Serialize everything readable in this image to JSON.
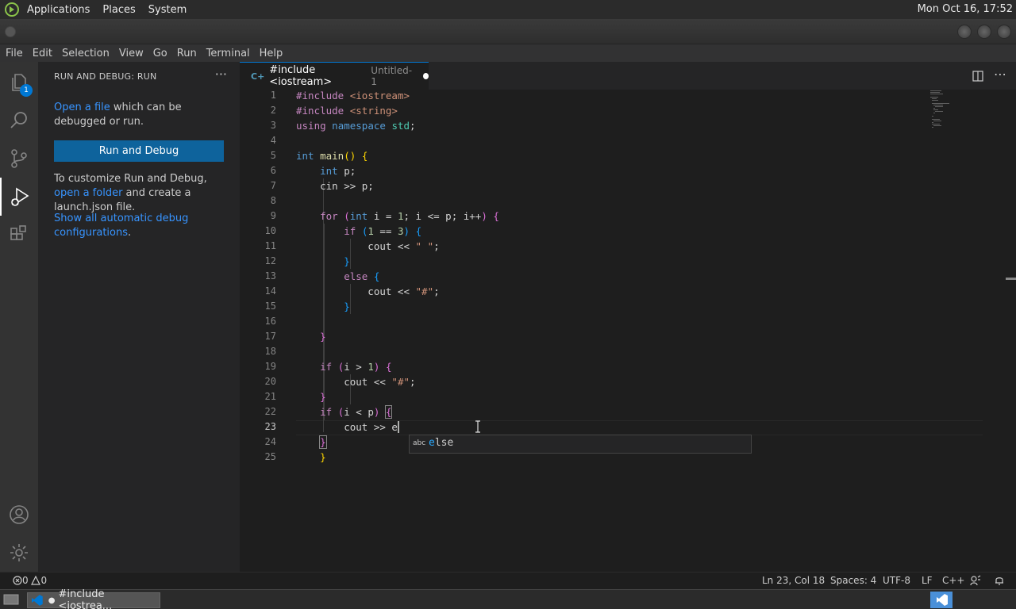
{
  "top_panel": {
    "menus": [
      "Applications",
      "Places",
      "System"
    ],
    "clock": "Mon Oct 16, 17:52"
  },
  "menu_bar": [
    "File",
    "Edit",
    "Selection",
    "View",
    "Go",
    "Run",
    "Terminal",
    "Help"
  ],
  "activity_bar": {
    "explorer_badge": "1",
    "icons": [
      "files-icon",
      "search-icon",
      "source-control-icon",
      "run-debug-icon",
      "extensions-icon",
      "account-icon",
      "gear-icon"
    ]
  },
  "sidebar": {
    "title": "RUN AND DEBUG: RUN",
    "more": "···",
    "open_file_link": "Open a file",
    "open_file_rest": " which can be debugged or run.",
    "run_button": "Run and Debug",
    "customize_prefix": "To customize Run and Debug, ",
    "open_folder_link": "open a folder",
    "customize_suffix": " and create a launch.json file.",
    "show_all_link": "Show all automatic debug configurations",
    "show_all_suffix": "."
  },
  "tab": {
    "icon": "C+",
    "title": "#include <iostream>",
    "subtitle": "Untitled-1"
  },
  "editor": {
    "line_numbers": [
      "1",
      "2",
      "3",
      "4",
      "5",
      "6",
      "7",
      "8",
      "9",
      "10",
      "11",
      "12",
      "13",
      "14",
      "15",
      "16",
      "17",
      "18",
      "19",
      "20",
      "21",
      "22",
      "23",
      "24",
      "25"
    ],
    "current_line": "23"
  },
  "suggest": {
    "kind": "abc",
    "match": "e",
    "rest": "lse"
  },
  "status_bar": {
    "problems_errors": "0",
    "problems_warnings": "0",
    "position": "Ln 23, Col 18",
    "spaces": "Spaces: 4",
    "encoding": "UTF-8",
    "eol": "LF",
    "language": "C++"
  },
  "taskbar": {
    "window_title": "#include <iostrea..."
  },
  "colors": {
    "accent": "#0078d4",
    "button": "#0e639c",
    "link": "#3794ff"
  }
}
